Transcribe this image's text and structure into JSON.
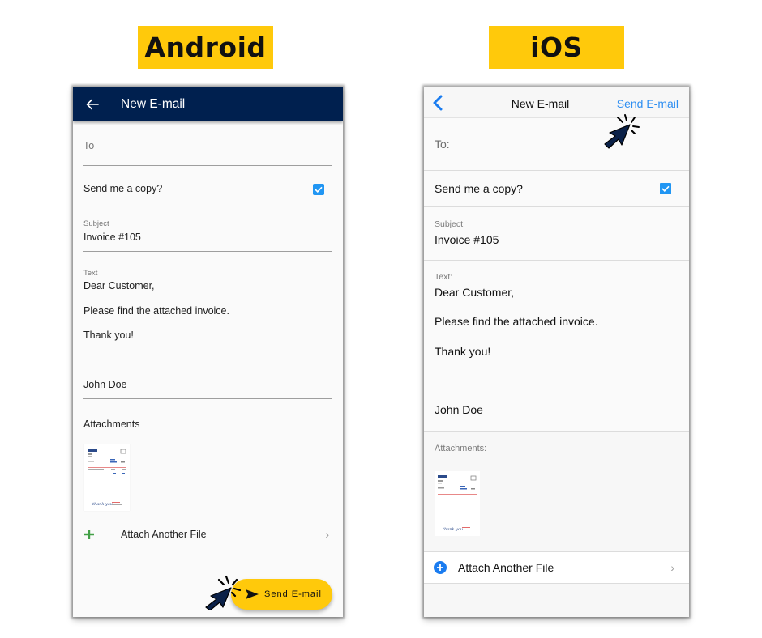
{
  "labels": {
    "android": "Android",
    "ios": "iOS"
  },
  "android": {
    "appbar": {
      "title": "New E-mail",
      "back_icon": "arrow-left-icon"
    },
    "to": {
      "placeholder": "To",
      "value": ""
    },
    "send_copy": {
      "label": "Send me a copy?",
      "checked": true
    },
    "subject": {
      "label": "Subject",
      "value": "Invoice #105"
    },
    "text": {
      "label": "Text",
      "lines": [
        "Dear Customer,",
        "Please find the attached invoice.",
        "Thank you!",
        "John Doe"
      ]
    },
    "attachments": {
      "label": "Attachments",
      "thumbnail": "invoice-thumbnail"
    },
    "attach_another": {
      "label": "Attach Another File",
      "icon": "plus-icon",
      "chevron": "›"
    },
    "fab": {
      "label": "Send E-mail",
      "icon": "send-icon"
    }
  },
  "ios": {
    "navbar": {
      "title": "New E-mail",
      "action": "Send E-mail",
      "back_icon": "chevron-left-icon"
    },
    "to": {
      "placeholder": "To:",
      "value": ""
    },
    "send_copy": {
      "label": "Send me a copy?",
      "checked": true
    },
    "subject": {
      "label": "Subject:",
      "value": "Invoice #105"
    },
    "text": {
      "label": "Text:",
      "lines": [
        "Dear Customer,",
        "Please find the attached invoice.",
        "Thank you!",
        "John Doe"
      ]
    },
    "attachments": {
      "label": "Attachments:",
      "thumbnail": "invoice-thumbnail"
    },
    "attach_another": {
      "label": "Attach Another File",
      "icon": "plus-circle-icon",
      "chevron": "›"
    }
  },
  "colors": {
    "tag_yellow": "#ffc90b",
    "android_appbar": "#00204f",
    "checkbox_blue": "#2196f3",
    "ios_link_blue": "#2f8ff2",
    "android_plus_green": "#43a047",
    "cursor_navy": "#0b2148"
  }
}
